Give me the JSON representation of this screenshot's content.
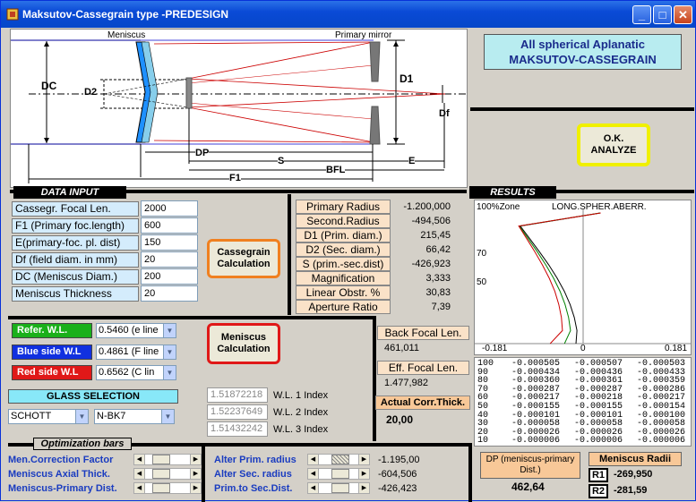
{
  "window": {
    "title": "Maksutov-Cassegrain type -PREDESIGN"
  },
  "title_box": {
    "line1": "All spherical  Aplanatic",
    "line2": "MAKSUTOV-CASSEGRAIN"
  },
  "diagram": {
    "meniscus": "Meniscus",
    "primary_mirror": "Primary mirror",
    "dc": "DC",
    "d2": "D2",
    "d1": "D1",
    "df": "Df",
    "dp": "DP",
    "s": "S",
    "e": "E",
    "bfl": "BFL",
    "f1": "F1"
  },
  "ok_analyze": {
    "line1": "O.K.",
    "line2": "ANALYZE"
  },
  "data_input": {
    "header": "DATA  INPUT",
    "rows": [
      {
        "label": "Cassegr. Focal  Len.",
        "value": "2000"
      },
      {
        "label": "F1 (Primary foc.length)",
        "value": "600"
      },
      {
        "label": "E(primary-foc. pl. dist)",
        "value": "150"
      },
      {
        "label": "Df  (field diam. in mm)",
        "value": "20"
      },
      {
        "label": "DC (Meniscus Diam.)",
        "value": "200"
      },
      {
        "label": "Meniscus  Thickness",
        "value": "20"
      }
    ],
    "cass_button": {
      "line1": "Cassegrain",
      "line2": "Calculation"
    }
  },
  "derived": [
    {
      "label": "Primary Radius",
      "value": "-1.200,000"
    },
    {
      "label": "Second.Radius",
      "value": "-494,506"
    },
    {
      "label": "D1 (Prim. diam.)",
      "value": "215,45"
    },
    {
      "label": "D2 (Sec. diam.)",
      "value": "66,42"
    },
    {
      "label": "S (prim.-sec.dist)",
      "value": "-426,923"
    },
    {
      "label": "Magnification",
      "value": "3,333"
    },
    {
      "label": "Linear Obstr. %",
      "value": "30,83"
    },
    {
      "label": "Aperture Ratio",
      "value": "7,39"
    }
  ],
  "results": {
    "header": "RESULTS",
    "chart_title": "LONG.SPHER.ABERR.",
    "zone_label": "100%Zone",
    "xmin": "-0.181",
    "xmax": "0.181",
    "xzero": "0",
    "y70": "70",
    "y50": "50"
  },
  "chart_data": {
    "type": "line",
    "title": "LONG.SPHER.ABERR.",
    "xlim": [
      -0.181,
      0.181
    ],
    "ylim": [
      0,
      100
    ],
    "series": [
      {
        "color": "#000000",
        "x": [
          -0.000505,
          -0.000434,
          -0.00036,
          -0.000287,
          -0.000217,
          -0.000155,
          -0.000101,
          -5.8e-05,
          -2.6e-05,
          -6e-06
        ],
        "y": [
          100,
          90,
          80,
          70,
          60,
          50,
          40,
          30,
          20,
          10
        ]
      },
      {
        "color": "#008000",
        "x": [
          -0.000507,
          -0.000436,
          -0.000361,
          -0.000287,
          -0.000218,
          -0.000155,
          -0.000101,
          -5.8e-05,
          -2.6e-05,
          -6e-06
        ],
        "y": [
          100,
          90,
          80,
          70,
          60,
          50,
          40,
          30,
          20,
          10
        ]
      },
      {
        "color": "#cc0000",
        "x": [
          -0.000503,
          -0.000433,
          -0.000359,
          -0.000286,
          -0.000217,
          -0.000154,
          -0.0001,
          -5.8e-05,
          -2.6e-05,
          -6e-06
        ],
        "y": [
          100,
          90,
          80,
          70,
          60,
          50,
          40,
          30,
          20,
          10
        ]
      }
    ]
  },
  "zones": [
    {
      "z": "100",
      "a": "-0.000505",
      "b": "-0.000507",
      "c": "-0.000503"
    },
    {
      "z": "90",
      "a": "-0.000434",
      "b": "-0.000436",
      "c": "-0.000433"
    },
    {
      "z": "80",
      "a": "-0.000360",
      "b": "-0.000361",
      "c": "-0.000359"
    },
    {
      "z": "70",
      "a": "-0.000287",
      "b": "-0.000287",
      "c": "-0.000286"
    },
    {
      "z": "60",
      "a": "-0.000217",
      "b": "-0.000218",
      "c": "-0.000217"
    },
    {
      "z": "50",
      "a": "-0.000155",
      "b": "-0.000155",
      "c": "-0.000154"
    },
    {
      "z": "40",
      "a": "-0.000101",
      "b": "-0.000101",
      "c": "-0.000100"
    },
    {
      "z": "30",
      "a": "-0.000058",
      "b": "-0.000058",
      "c": "-0.000058"
    },
    {
      "z": "20",
      "a": "-0.000026",
      "b": "-0.000026",
      "c": "-0.000026"
    },
    {
      "z": "10",
      "a": "-0.000006",
      "b": "-0.000006",
      "c": "-0.000006"
    }
  ],
  "wavelengths": {
    "refer": {
      "label": "Refer.  W.L.",
      "value": "0.5460  (e  line"
    },
    "blue": {
      "label": "Blue side W.L",
      "value": "0.4861  (F  line"
    },
    "red": {
      "label": "Red side W.L",
      "value": "0.6562  (C  lin"
    }
  },
  "meniscus_button": {
    "line1": "Meniscus",
    "line2": "Calculation"
  },
  "glass": {
    "header": "GLASS    SELECTION",
    "maker": "SCHOTT",
    "type": "N-BK7",
    "indices": [
      {
        "value": "1.51872218",
        "label": "W.L. 1  Index"
      },
      {
        "value": "1.52237649",
        "label": "W.L. 2  Index"
      },
      {
        "value": "1.51432242",
        "label": "W.L. 3  Index"
      }
    ]
  },
  "focal": {
    "bfl_label": "Back Focal Len.",
    "bfl_value": "461,011",
    "efl_label": "Eff. Focal Len.",
    "efl_value": "1.477,982",
    "act_label": "Actual Corr.Thick.",
    "act_value": "20,00"
  },
  "optimization": {
    "header": "Optimization bars",
    "left": [
      {
        "label": "Men.Correction Factor"
      },
      {
        "label": "Meniscus Axial Thick."
      },
      {
        "label": "Meniscus-Primary  Dist."
      }
    ],
    "right": [
      {
        "label": "Alter Prim.  radius",
        "value": "-1.195,00"
      },
      {
        "label": "Alter Sec.  radius",
        "value": "-604,506"
      },
      {
        "label": "Prim.to Sec.Dist.",
        "value": "-426,423"
      }
    ]
  },
  "dp_box": {
    "label": "DP (meniscus-primary Dist.)",
    "value": "462,64"
  },
  "radii": {
    "header": "Meniscus  Radii",
    "r1_label": "R1",
    "r1": "-269,950",
    "r2_label": "R2",
    "r2": "-281,59"
  }
}
